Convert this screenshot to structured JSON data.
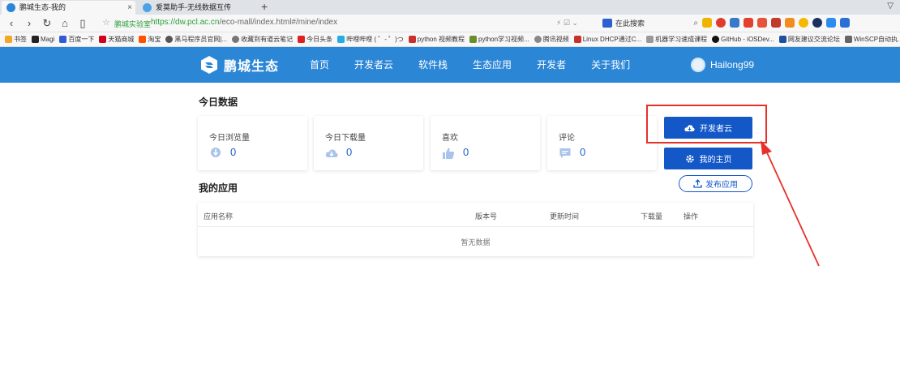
{
  "browser": {
    "tabs": [
      {
        "title": "鹏城生态-我的",
        "active": true
      },
      {
        "title": "爱莫助手-无线数据互传",
        "active": false
      }
    ],
    "site_label": "鹏城实验室",
    "url_host": "https://dw.pcl.ac.cn",
    "url_path": "/eco-mall/index.html#/mine/index",
    "search_placeholder": "在此搜索",
    "bookmarks": [
      "书签",
      "Magi",
      "百度一下",
      "天猫商城",
      "淘宝",
      "黑马程序员官网|...",
      "收藏到有道云笔记",
      "今日头条",
      "哔哩哔哩 ( ゜- ゜)つ",
      "python 视频教程",
      "python学习视频...",
      "腾讯视频",
      "Linux DHCP通过C...",
      "机器学习速成课程",
      "GitHub - iOSDev...",
      "网友建议交流论坛",
      "WinSCP自动执..."
    ]
  },
  "header": {
    "logo_text": "鹏城生态",
    "nav": [
      "首页",
      "开发者云",
      "软件栈",
      "生态应用",
      "开发者",
      "关于我们"
    ],
    "username": "Hailong99"
  },
  "today": {
    "title": "今日数据",
    "stats": [
      {
        "label": "今日浏览量",
        "value": "0",
        "icon": "pin-icon"
      },
      {
        "label": "今日下载量",
        "value": "0",
        "icon": "cloud-download-icon"
      },
      {
        "label": "喜欢",
        "value": "0",
        "icon": "thumbs-up-icon"
      },
      {
        "label": "评论",
        "value": "0",
        "icon": "comment-icon"
      }
    ]
  },
  "actions": {
    "dev_cloud": "开发者云",
    "my_home": "我的主页",
    "publish": "发布应用"
  },
  "apps": {
    "title": "我的应用",
    "columns": [
      "应用名称",
      "版本号",
      "更新时间",
      "下载量",
      "操作"
    ],
    "empty": "暂无数据"
  },
  "colors": {
    "header_bg": "#2b86d6",
    "primary": "#1458c8",
    "annotation": "#e8302a"
  }
}
